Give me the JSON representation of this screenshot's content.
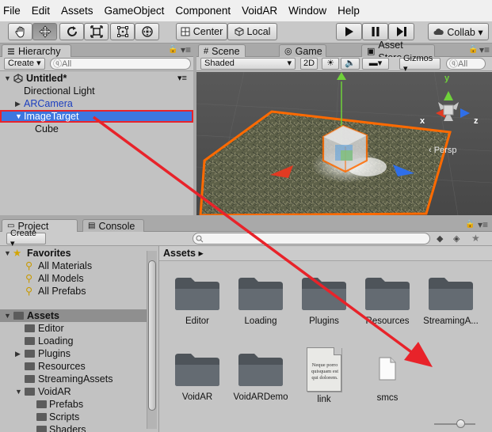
{
  "menu": [
    "File",
    "Edit",
    "Assets",
    "GameObject",
    "Component",
    "VoidAR",
    "Window",
    "Help"
  ],
  "toolbar": {
    "tools": [
      "hand-icon",
      "move-icon",
      "rotate-icon",
      "scale-icon",
      "rect-icon",
      "transform-icon"
    ],
    "pivot_center": "Center",
    "pivot_local": "Local",
    "collab": "Collab ▾"
  },
  "hierarchy": {
    "tab": "Hierarchy",
    "create": "Create ▾",
    "search_placeholder": "ⓠAll",
    "scene_name": "Untitled*",
    "items": [
      {
        "label": "Directional Light"
      },
      {
        "label": "ARCamera"
      },
      {
        "label": "ImageTarget"
      },
      {
        "label": "Cube"
      }
    ]
  },
  "scene": {
    "tabs": [
      "Scene",
      "Game",
      "Asset Store"
    ],
    "shading": "Shaded",
    "mode_2d": "2D",
    "gizmos": "Gizmos ▾",
    "search_placeholder": "ⓠAll",
    "persp": "‹ Persp",
    "axis_y": "y",
    "axis_x": "x",
    "axis_z": "z"
  },
  "project": {
    "tabs": [
      "Project",
      "Console"
    ],
    "create": "Create ▾",
    "favorites_title": "Favorites",
    "favorites": [
      "All Materials",
      "All Models",
      "All Prefabs"
    ],
    "assets_title": "Assets",
    "tree": [
      "Editor",
      "Loading",
      "Plugins",
      "Resources",
      "StreamingAssets",
      "VoidAR",
      "Prefabs",
      "Scripts",
      "Shaders"
    ],
    "breadcrumb": "Assets ▸",
    "grid": [
      {
        "label": "Editor",
        "kind": "folder"
      },
      {
        "label": "Loading",
        "kind": "folder"
      },
      {
        "label": "Plugins",
        "kind": "folder"
      },
      {
        "label": "Resources",
        "kind": "folder"
      },
      {
        "label": "StreamingA...",
        "kind": "folder"
      },
      {
        "label": "VoidAR",
        "kind": "folder"
      },
      {
        "label": "VoidARDemo",
        "kind": "folder"
      },
      {
        "label": "link",
        "kind": "doc",
        "doc_text": "Neque porro quisquam est qui dolorem."
      },
      {
        "label": "smcs",
        "kind": "file"
      }
    ]
  },
  "colors": {
    "selection_blue": "#3d77e0",
    "highlight_red": "#e8232a",
    "gizmo_orange": "#ff6a00",
    "gizmo_green": "#6fd13a"
  }
}
